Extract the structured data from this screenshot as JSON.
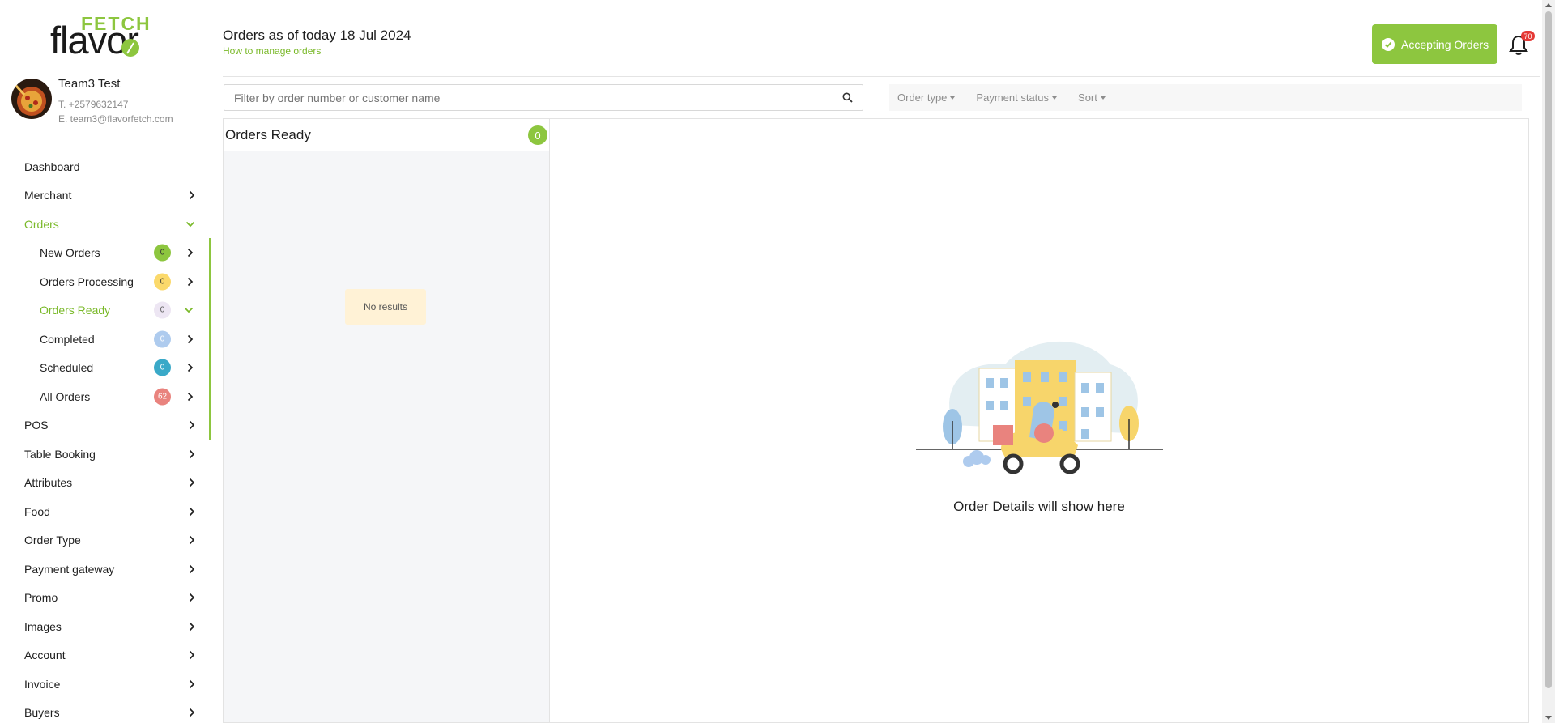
{
  "brand": {
    "logo_top": "FETCH",
    "logo_bottom": "flavor",
    "accent": "#8dc63f"
  },
  "profile": {
    "name": "Team3 Test",
    "phone": "T. +2579632147",
    "email": "E. team3@flavorfetch.com"
  },
  "nav": {
    "dashboard": "Dashboard",
    "merchant": "Merchant",
    "orders": "Orders",
    "orders_sub": [
      {
        "label": "New Orders",
        "count": "0",
        "color": "#8dc63f",
        "text_color": "#333"
      },
      {
        "label": "Orders Processing",
        "count": "0",
        "color": "#fbd96b",
        "text_color": "#333"
      },
      {
        "label": "Orders Ready",
        "count": "0",
        "color": "#ede6f3",
        "text_color": "#555"
      },
      {
        "label": "Completed",
        "count": "0",
        "color": "#aecbee",
        "text_color": "#fff"
      },
      {
        "label": "Scheduled",
        "count": "0",
        "color": "#3aa9c8",
        "text_color": "#fff"
      },
      {
        "label": "All Orders",
        "count": "62",
        "color": "#e9837e",
        "text_color": "#fff"
      }
    ],
    "items_after": [
      "POS",
      "Table Booking",
      "Attributes",
      "Food",
      "Order Type",
      "Payment gateway",
      "Promo",
      "Images",
      "Account",
      "Invoice",
      "Buyers"
    ]
  },
  "header": {
    "title": "Orders as of today 18 Jul 2024",
    "help_link": "How to manage orders",
    "accepting_label": "Accepting Orders",
    "notification_count": "70"
  },
  "search": {
    "placeholder": "Filter by order number or customer name",
    "value": ""
  },
  "filters": {
    "order_type": "Order type",
    "payment_status": "Payment status",
    "sort": "Sort"
  },
  "list": {
    "title": "Orders Ready",
    "count": "0",
    "empty_text": "No results"
  },
  "detail": {
    "caption": "Order Details will show here"
  }
}
